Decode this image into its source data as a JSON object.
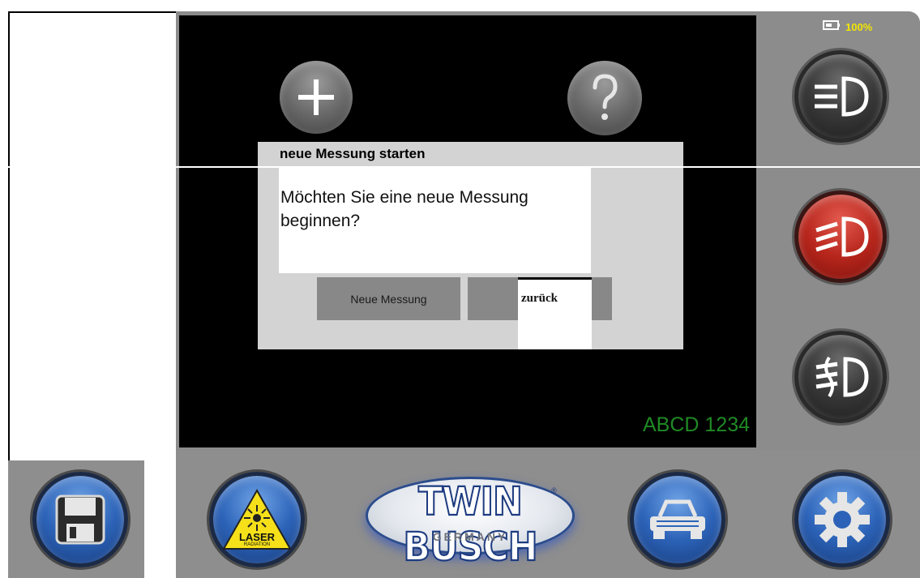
{
  "battery": {
    "label": "100%",
    "icon": "battery-icon"
  },
  "top_icons": [
    {
      "icon": "plus-icon"
    },
    {
      "icon": "help-icon"
    }
  ],
  "side_buttons": [
    {
      "icon": "low-beam-icon"
    },
    {
      "icon": "high-beam-icon"
    },
    {
      "icon": "fog-light-icon"
    }
  ],
  "dialog": {
    "title": "neue Messung starten",
    "message": "Möchten Sie eine neue Messung beginnen?",
    "confirm_label": "Neue Messung",
    "back_label": "zurück"
  },
  "license_plate": "ABCD 1234",
  "bottom_buttons": [
    {
      "icon": "save-icon"
    },
    {
      "icon": "laser-icon",
      "label": "LASER",
      "sublabel": "RADIATION"
    },
    {
      "icon": "car-icon"
    },
    {
      "icon": "settings-icon"
    }
  ],
  "logo": {
    "main": "TWIN BUSCH",
    "registered": "®",
    "sub": "GERMANY"
  },
  "colors": {
    "plate_text": "#1f8a25",
    "battery_text": "#f2e600",
    "screen": "#000000",
    "frame": "#8c8c8c",
    "logo_blue": "#1d3b80"
  }
}
